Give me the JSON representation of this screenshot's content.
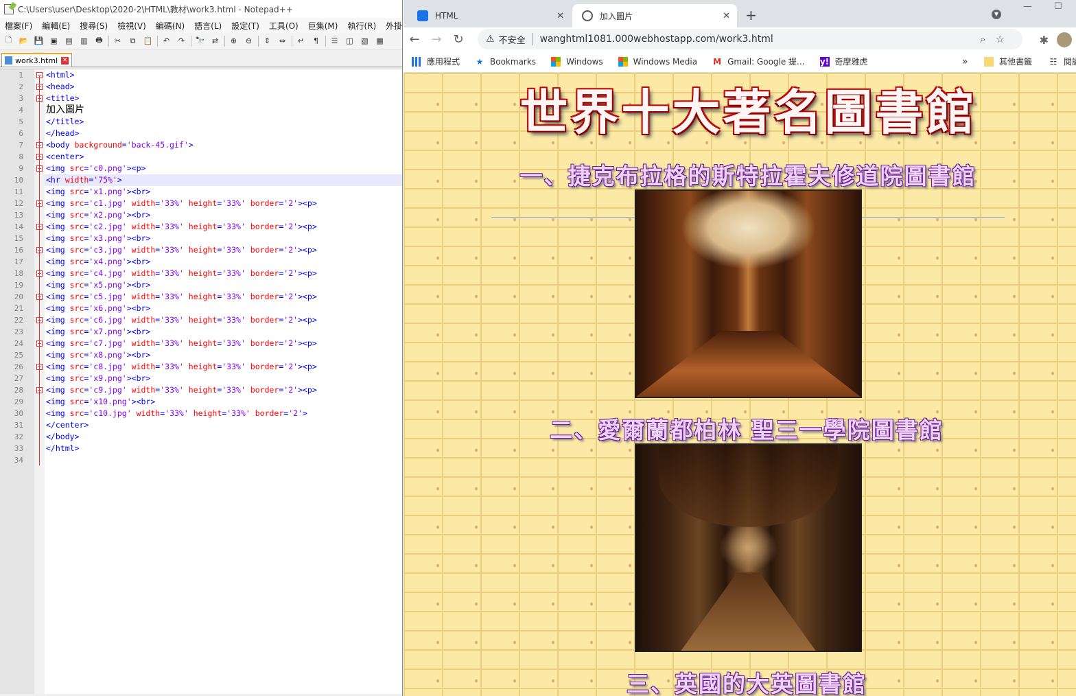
{
  "notepad": {
    "title": "C:\\Users\\user\\Desktop\\2020-2\\HTML\\教材\\work3.html - Notepad++",
    "menu": [
      "檔案(F)",
      "編輯(E)",
      "搜尋(S)",
      "檢視(V)",
      "編碼(N)",
      "語言(L)",
      "設定(T)",
      "工具(O)",
      "巨集(M)",
      "執行(R)",
      "外掛(P)"
    ],
    "tab_label": "work3.html",
    "line_numbers": [
      "1",
      "2",
      "3",
      "4",
      "5",
      "6",
      "7",
      "8",
      "9",
      "10",
      "11",
      "12",
      "13",
      "14",
      "15",
      "16",
      "17",
      "18",
      "19",
      "20",
      "21",
      "22",
      "23",
      "24",
      "25",
      "26",
      "27",
      "28",
      "29",
      "30",
      "31",
      "32",
      "33",
      "34"
    ]
  },
  "chrome": {
    "tabs": [
      {
        "label": "HTML"
      },
      {
        "label": "加入圖片"
      }
    ],
    "address": {
      "security_label": "不安全",
      "url": "wanghtml1081.000webhostapp.com/work3.html"
    },
    "bookmarks": [
      {
        "label": "應用程式"
      },
      {
        "label": "Bookmarks"
      },
      {
        "label": "Windows"
      },
      {
        "label": "Windows Media"
      },
      {
        "label": "Gmail: Google 提..."
      },
      {
        "label": "奇摩雅虎"
      }
    ],
    "bookmarks_more": "»",
    "bookmarks_other": "其他書籤",
    "reading_list": "閱讀"
  },
  "page": {
    "title": "世界十大著名圖書館",
    "headings": [
      "一、捷克布拉格的斯特拉霍夫修道院圖書館",
      "二、愛爾蘭都柏林 聖三一學院圖書館",
      "三、英國的大英圖書館"
    ]
  }
}
